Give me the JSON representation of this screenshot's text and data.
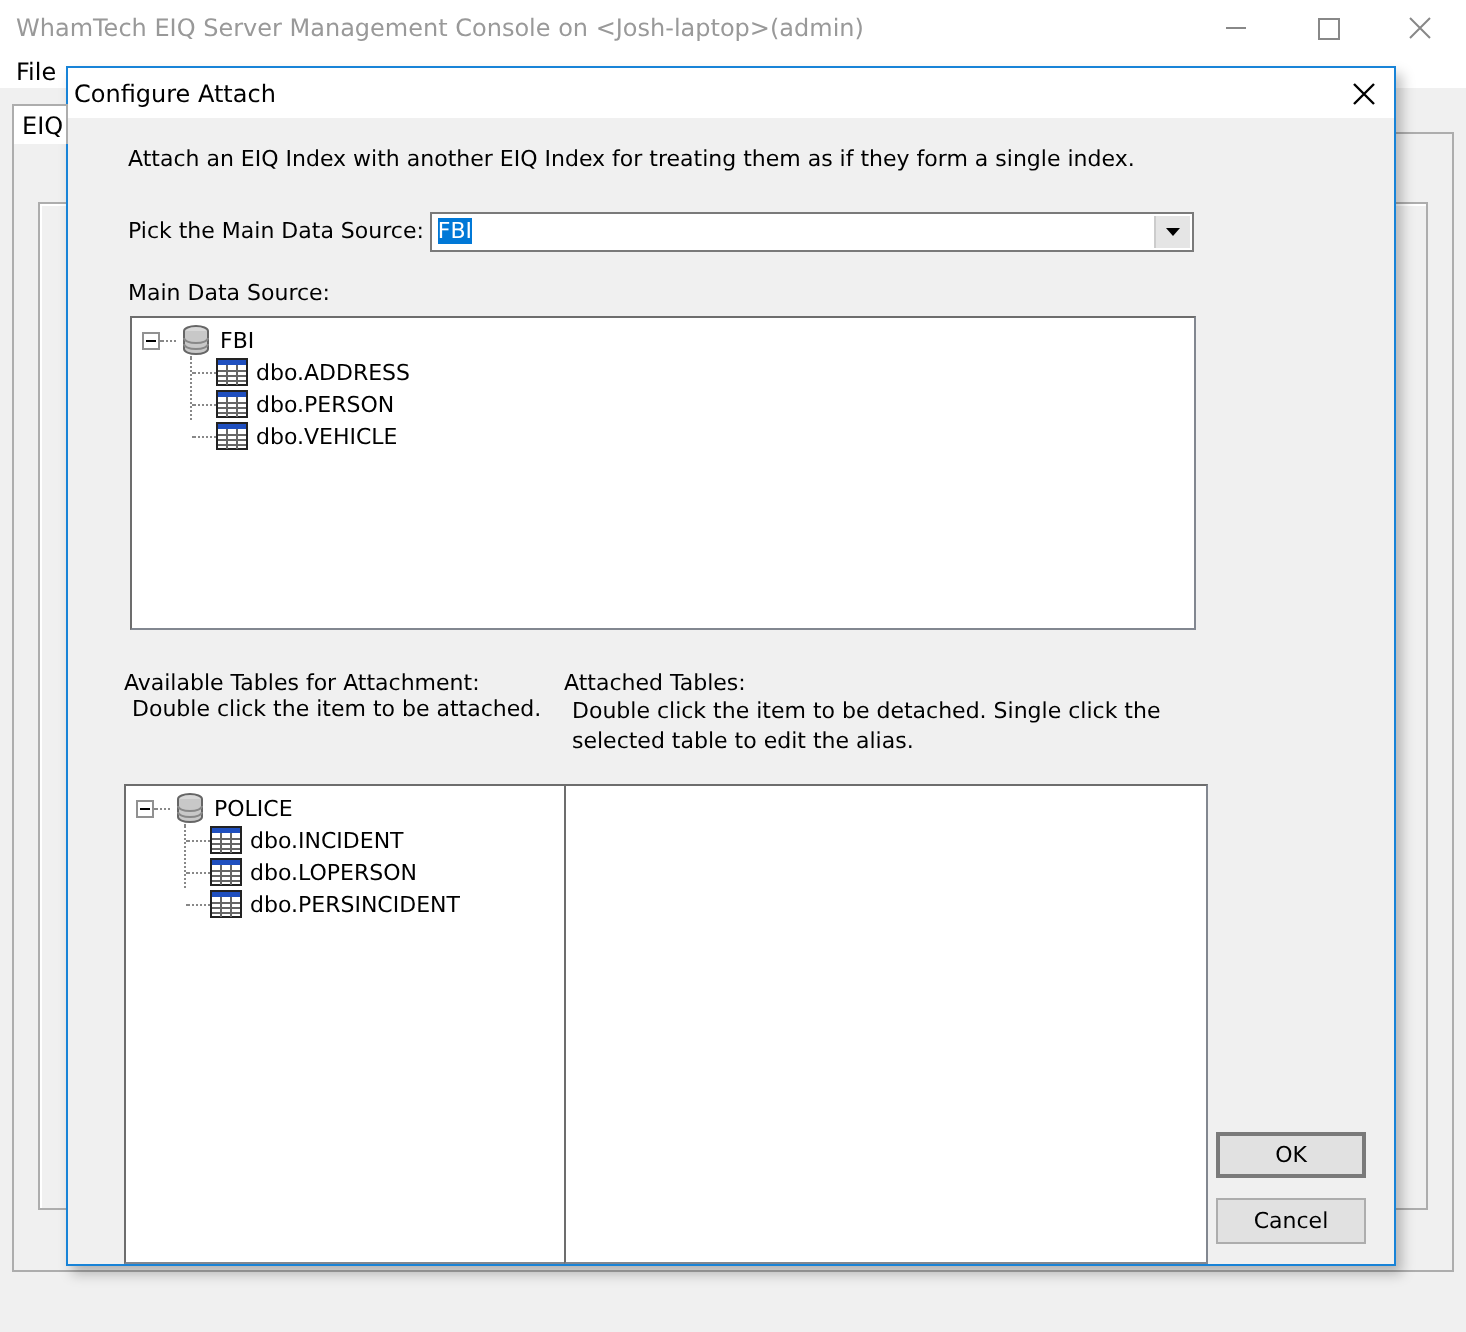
{
  "window": {
    "title": "WhamTech EIQ Server Management Console on <Josh-laptop>(admin)"
  },
  "menu": [
    "File"
  ],
  "tabs": [
    {
      "label": "EIQ",
      "selected": true
    }
  ],
  "dialog": {
    "title": "Configure Attach",
    "description": "Attach an EIQ Index with another EIQ Index for treating them as if they form a single index.",
    "main_source": {
      "label": "Pick the Main Data Source:",
      "value": "FBI",
      "highlighted": true
    },
    "main_tree": {
      "label": "Main Data Source:",
      "root": {
        "label": "FBI",
        "expanded": true,
        "children": [
          {
            "label": "dbo.ADDRESS"
          },
          {
            "label": "dbo.PERSON"
          },
          {
            "label": "dbo.VEHICLE"
          }
        ]
      }
    },
    "available": {
      "label": "Available Tables for Attachment:",
      "hint": "Double click the item to be attached.",
      "root": {
        "label": "POLICE",
        "expanded": true,
        "children": [
          {
            "label": "dbo.INCIDENT"
          },
          {
            "label": "dbo.LOPERSON"
          },
          {
            "label": "dbo.PERSINCIDENT"
          }
        ]
      }
    },
    "attached": {
      "label": "Attached Tables:",
      "hint": "Double click the item to be detached. Single click the selected table to edit the alias."
    },
    "buttons": [
      "OK",
      "Cancel"
    ]
  }
}
